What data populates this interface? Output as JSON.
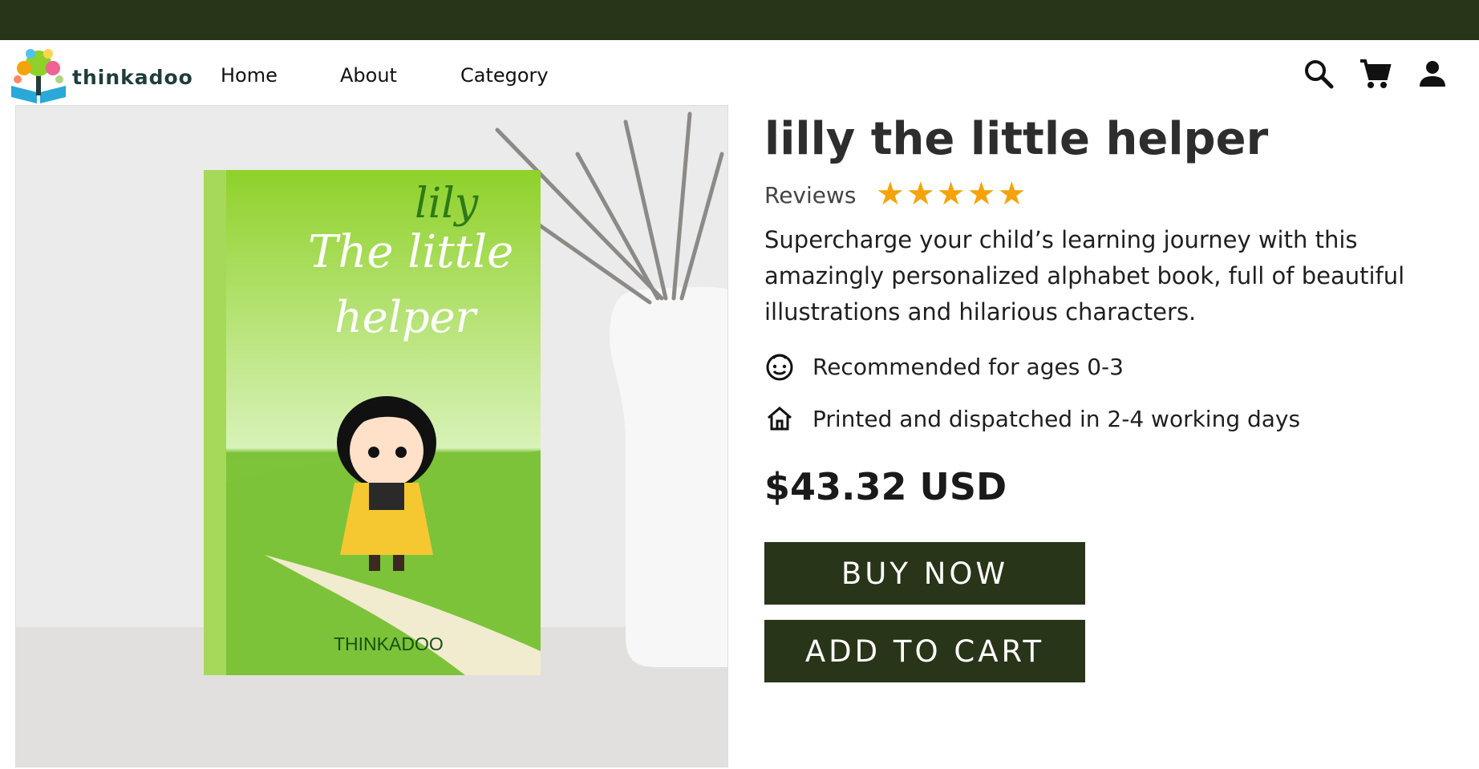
{
  "brand": {
    "name": "thinkadoo"
  },
  "nav": {
    "links": [
      "Home",
      "About",
      "Category"
    ],
    "icons": [
      "search-icon",
      "cart-icon",
      "user-icon"
    ]
  },
  "product": {
    "title": "lilly the little helper",
    "reviews_label": "Reviews",
    "rating": 5,
    "rating_stars": "★★★★★",
    "description": "Supercharge your child’s learning journey with this amazingly personalized alphabet book, full of beautiful illustrations and hilarious characters.",
    "features": [
      {
        "icon": "face-icon",
        "text": "Recommended for ages 0-3"
      },
      {
        "icon": "home-icon",
        "text": "Printed and dispatched in 2-4 working days"
      }
    ],
    "price": "$43.32 USD",
    "buy_now_label": "BUY NOW",
    "add_to_cart_label": "ADD TO CART"
  },
  "book_cover": {
    "line1": "lily",
    "line2": "The little",
    "line3": "helper",
    "publisher": "THINKADOO"
  },
  "colors": {
    "topbar": "#283518",
    "button": "#283518",
    "star": "#f5a30a",
    "book_green": "#8fd12a"
  }
}
